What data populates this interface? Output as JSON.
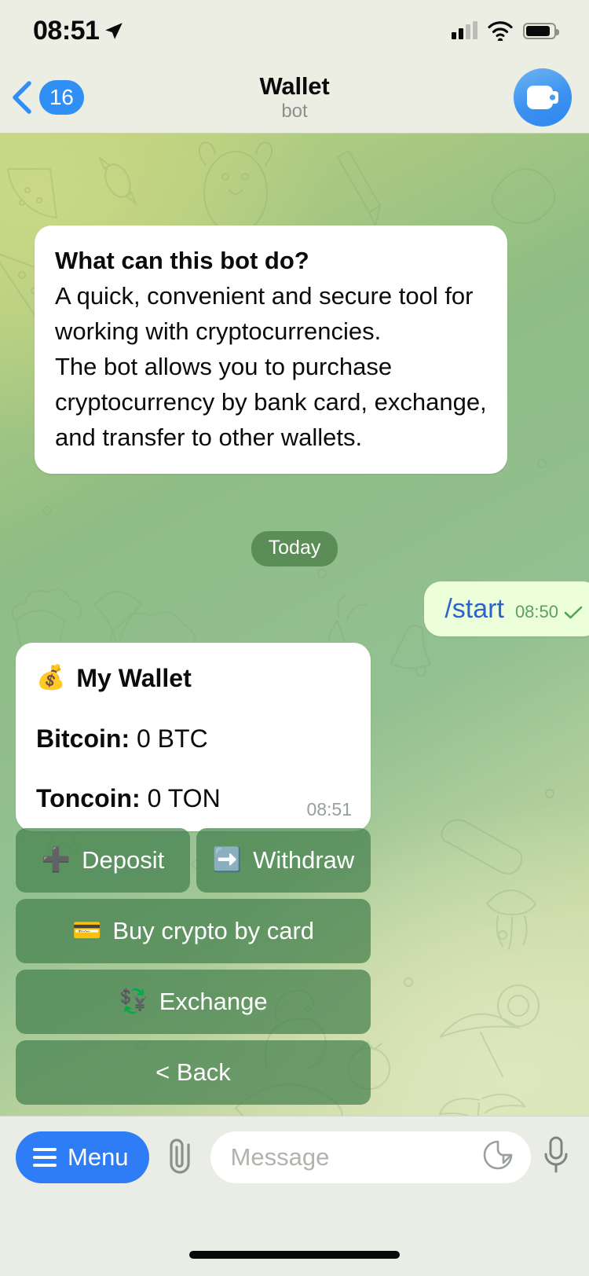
{
  "status_bar": {
    "time": "08:51",
    "location_icon": "location-arrow-icon",
    "cellular_icon": "cellular-bars-icon",
    "wifi_icon": "wifi-icon",
    "battery_icon": "battery-icon"
  },
  "nav": {
    "back_icon": "chevron-left-icon",
    "back_badge": "16",
    "title": "Wallet",
    "subtitle": "bot",
    "avatar_icon": "wallet-icon"
  },
  "chat": {
    "bot_info": {
      "title": "What can this bot do?",
      "lines": [
        "A quick, convenient and secure tool for",
        "working with cryptocurrencies.",
        "The bot allows you to purchase",
        "cryptocurrency by bank card, exchange,",
        "and transfer to other wallets."
      ]
    },
    "date_divider": "Today",
    "outgoing": {
      "text": "/start",
      "time": "08:50",
      "status_icon": "check-sent-icon"
    },
    "wallet_card": {
      "emoji": "💰",
      "title": "My Wallet",
      "rows": [
        {
          "label": "Bitcoin:",
          "value": "0 BTC"
        },
        {
          "label": "Toncoin:",
          "value": "0 TON"
        }
      ],
      "time": "08:51"
    },
    "keyboard": [
      [
        {
          "emoji": "➕",
          "label": "Deposit"
        },
        {
          "emoji": "➡️",
          "label": "Withdraw"
        }
      ],
      [
        {
          "emoji": "💳",
          "label": "Buy crypto by card"
        }
      ],
      [
        {
          "emoji": "💱",
          "label": "Exchange"
        }
      ],
      [
        {
          "emoji": "",
          "label": "< Back"
        }
      ]
    ]
  },
  "input_bar": {
    "menu_label": "Menu",
    "menu_icon": "hamburger-icon",
    "attach_icon": "paperclip-icon",
    "message_placeholder": "Message",
    "sticker_icon": "sticker-icon",
    "mic_icon": "microphone-icon"
  },
  "colors": {
    "accent_blue": "#2F7DF6",
    "bubble_out": "#EDFFDA",
    "command_blue": "#2B62CE",
    "button_green": "#44804E",
    "time_green": "#5DA05B"
  }
}
